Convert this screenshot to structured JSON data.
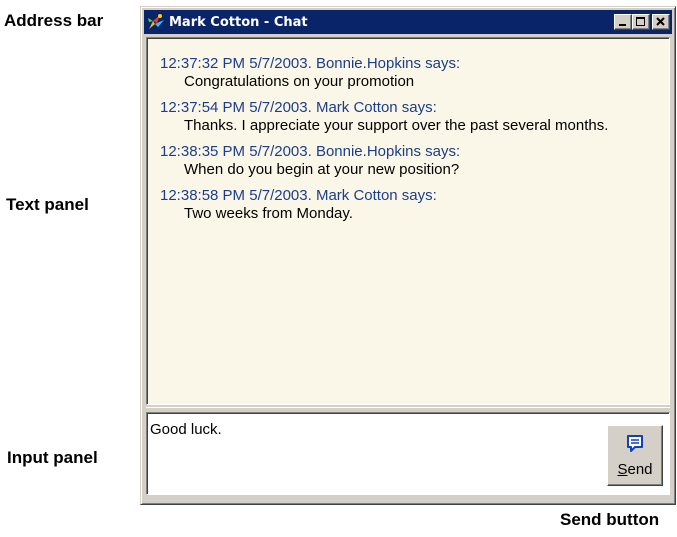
{
  "callouts": {
    "address_bar": "Address bar",
    "text_panel": "Text panel",
    "input_panel": "Input panel",
    "send_button": "Send button"
  },
  "window": {
    "title": "Mark Cotton - Chat",
    "app_icon": "chat-app-icon",
    "controls": [
      "minimize-icon",
      "maximize-icon",
      "close-icon"
    ],
    "titlebar_color": "#0a246a"
  },
  "messages": [
    {
      "header": "12:37:32 PM 5/7/2003. Bonnie.Hopkins says:",
      "body": "Congratulations on your promotion"
    },
    {
      "header": "12:37:54 PM 5/7/2003. Mark Cotton says:",
      "body": "Thanks. I appreciate your support over the past several months."
    },
    {
      "header": "12:38:35 PM 5/7/2003. Bonnie.Hopkins says:",
      "body": "When do you begin at your new position?"
    },
    {
      "header": "12:38:58 PM 5/7/2003. Mark Cotton says:",
      "body": "Two weeks from Monday."
    }
  ],
  "input": {
    "value": "Good luck."
  },
  "send_button": {
    "label_mnemonic": "S",
    "label_rest": "end",
    "icon": "send-message-icon"
  },
  "colors": {
    "message_header": "#1c3e8a",
    "text_panel_bg": "#fbf7e8",
    "chrome": "#d4d0c8"
  }
}
